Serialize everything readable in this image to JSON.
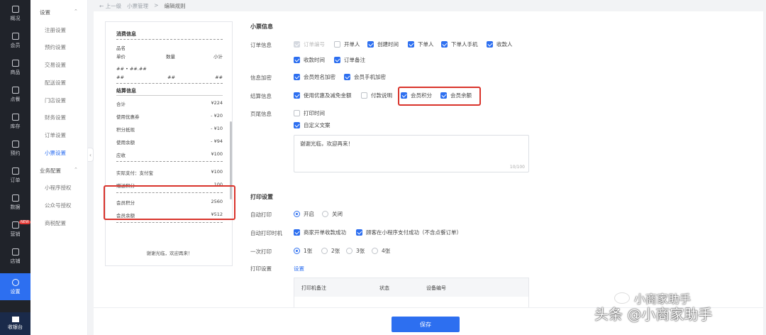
{
  "nav": {
    "items": [
      {
        "label": "概况",
        "icon": "grid-icon"
      },
      {
        "label": "会员",
        "icon": "crown-icon"
      },
      {
        "label": "商品",
        "icon": "shop-icon"
      },
      {
        "label": "点餐",
        "icon": "food-icon"
      },
      {
        "label": "库存",
        "icon": "box-icon"
      },
      {
        "label": "预约",
        "icon": "calendar-check-icon"
      },
      {
        "label": "订单",
        "icon": "document-icon"
      },
      {
        "label": "数据",
        "icon": "chart-icon"
      },
      {
        "label": "营销",
        "icon": "gift-icon"
      },
      {
        "label": "店铺",
        "icon": "store-icon"
      },
      {
        "label": "设置",
        "icon": "settings-icon"
      }
    ],
    "badge": "NEW",
    "cashier_label": "收银台"
  },
  "submenu": {
    "group1_title": "设置",
    "group1_items": [
      "注册设置",
      "预约设置",
      "交易设置",
      "配送设置",
      "门店设置",
      "财务设置",
      "订单设置",
      "小票设置"
    ],
    "group2_title": "业务配置",
    "group2_items": [
      "小程序授权",
      "公众号授权",
      "商税配置"
    ]
  },
  "breadcrumb": {
    "back": "← 上一级",
    "parent": "小票管理",
    "sep": ">",
    "current": "编辑规则"
  },
  "receipt": {
    "consume_title": "消费信息",
    "item_name": "品名",
    "col_price": "单价",
    "col_qty": "数量",
    "col_subtotal": "小计",
    "placeholder_row1": "## • ##.##",
    "placeholder_a": "##",
    "placeholder_b": "##",
    "placeholder_c": "##",
    "settle_title": "结算信息",
    "rows": [
      {
        "label": "合计",
        "value": "¥224"
      },
      {
        "label": "使用优惠券",
        "value": "- ¥20"
      },
      {
        "label": "积分抵现",
        "value": "- ¥10"
      },
      {
        "label": "使用余额",
        "value": "- ¥94"
      },
      {
        "label": "应收",
        "value": "¥100"
      }
    ],
    "actual_pay_label": "实际支付：支付宝",
    "actual_pay_value": "¥100",
    "gift_points_label": "赠送积分",
    "gift_points_value": "100",
    "member_points_label": "会员积分",
    "member_points_value": "2560",
    "member_balance_label": "会员余额",
    "member_balance_value": "¥512",
    "footer": "谢谢光临，欢迎再来！"
  },
  "settings": {
    "receipt_info_title": "小票信息",
    "order_info_label": "订单信息",
    "order_info_options": [
      {
        "label": "订单编号",
        "checked": true,
        "disabled": true
      },
      {
        "label": "开单人",
        "checked": false
      },
      {
        "label": "创建时间",
        "checked": true
      },
      {
        "label": "下单人",
        "checked": true
      },
      {
        "label": "下单人手机",
        "checked": true
      },
      {
        "label": "收款人",
        "checked": true
      },
      {
        "label": "收款时间",
        "checked": true
      },
      {
        "label": "订单备注",
        "checked": true
      }
    ],
    "encrypt_label": "信息加密",
    "encrypt_options": [
      {
        "label": "会员姓名加密",
        "checked": true
      },
      {
        "label": "会员手机加密",
        "checked": true
      }
    ],
    "settle_label": "结算信息",
    "settle_options": [
      {
        "label": "使用优惠及减免金额",
        "checked": true
      },
      {
        "label": "付款说明",
        "checked": false
      },
      {
        "label": "会员积分",
        "checked": true
      },
      {
        "label": "会员余额",
        "checked": true
      }
    ],
    "footer_label": "页尾信息",
    "footer_options": [
      {
        "label": "打印时间",
        "checked": false
      },
      {
        "label": "自定义文案",
        "checked": true
      }
    ],
    "custom_text": "谢谢光临，欢迎再来！",
    "custom_text_count": "10/100",
    "print_title": "打印设置",
    "auto_print_label": "自动打印",
    "auto_print_on": "开启",
    "auto_print_off": "关闭",
    "auto_print_time_label": "自动打印时机",
    "auto_print_time_options": [
      {
        "label": "商家开单收款成功",
        "checked": true
      },
      {
        "label": "顾客在小程序支付成功（不含点餐订单）",
        "checked": true
      }
    ],
    "copies_label": "一次打印",
    "copies_options": [
      "1张",
      "2张",
      "3张",
      "4张"
    ],
    "print_setting_label": "打印设置",
    "print_setting_link": "设置",
    "printer_table_headers": [
      "打印机备注",
      "状态",
      "设备编号"
    ]
  },
  "save_label": "保存",
  "watermark": {
    "line1": "小商家助手",
    "line2": "头条 @小商家助手"
  },
  "colors": {
    "accent": "#2d6ff0",
    "highlight_border": "#d9332b",
    "nav_bg": "#20232a"
  }
}
